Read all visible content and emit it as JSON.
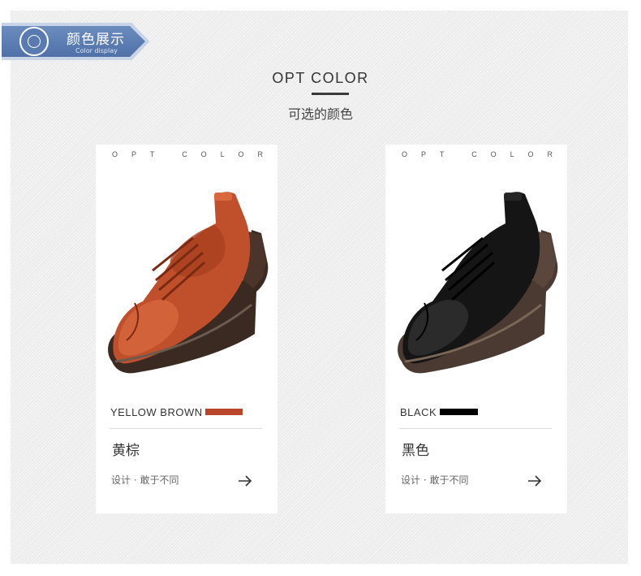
{
  "header": {
    "ribbon_title": "颜色展示",
    "ribbon_subtitle": "Color display",
    "ribbon_color": "#5a7bb2"
  },
  "section": {
    "heading": "OPT COLOR",
    "subheading": "可选的颜色"
  },
  "cards": [
    {
      "opt_letters": [
        "O",
        "P",
        "T",
        "",
        "C",
        "O",
        "L",
        "O",
        "R"
      ],
      "color_name": "YELLOW BROWN",
      "swatch_color": "#b9452a",
      "cn_name": "黄棕",
      "tagline": "设计 · 敢于不同",
      "icons": {
        "arrow": "arrow-right-icon"
      }
    },
    {
      "opt_letters": [
        "O",
        "P",
        "T",
        "",
        "C",
        "O",
        "L",
        "O",
        "R"
      ],
      "color_name": "BLACK",
      "swatch_color": "#000000",
      "cn_name": "黑色",
      "tagline": "设计 · 敢于不同",
      "icons": {
        "arrow": "arrow-right-icon"
      }
    }
  ]
}
